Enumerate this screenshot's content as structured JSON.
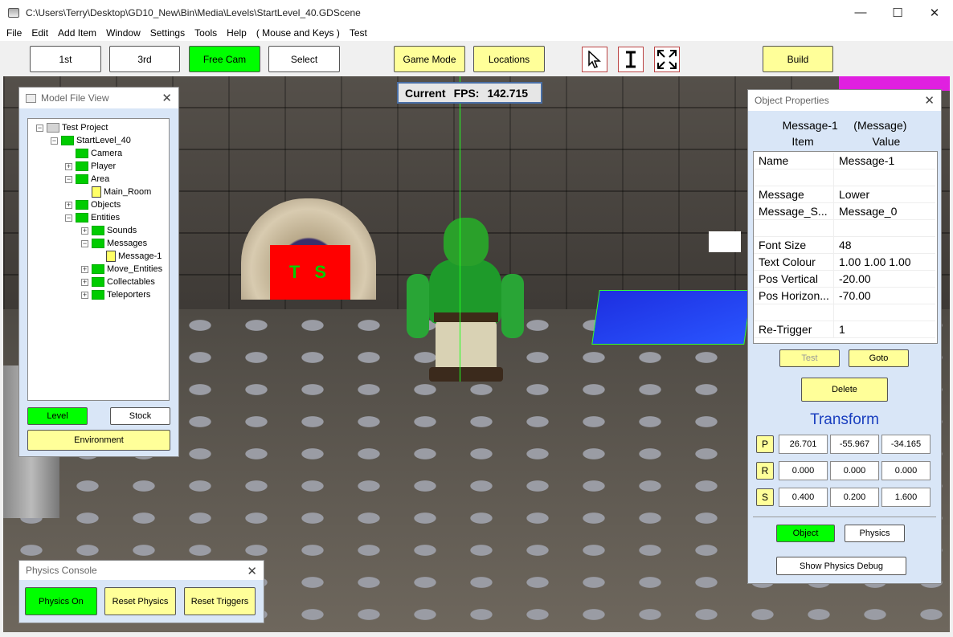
{
  "window": {
    "title": "C:\\Users\\Terry\\Desktop\\GD10_New\\Bin\\Media\\Levels\\StartLevel_40.GDScene",
    "minimize_glyph": "—",
    "maximize_glyph": "☐",
    "close_glyph": "✕"
  },
  "menu": [
    "File",
    "Edit",
    "Add Item",
    "Window",
    "Settings",
    "Tools",
    "Help",
    "( Mouse and Keys )",
    "Test"
  ],
  "toolbar": {
    "first": "1st",
    "third": "3rd",
    "free_cam": "Free Cam",
    "select": "Select",
    "game_mode": "Game Mode",
    "locations": "Locations",
    "build": "Build"
  },
  "viewport": {
    "fps_label": "Current",
    "fps_name": "FPS:",
    "fps_value": "142.715",
    "ts_text": "T S"
  },
  "model_file_view": {
    "title": "Model File View",
    "close": "✕",
    "tree": [
      {
        "label": "Test Project",
        "depth": 0,
        "icon": "folder-grey",
        "expander": "−"
      },
      {
        "label": "StartLevel_40",
        "depth": 1,
        "icon": "folder",
        "expander": "−"
      },
      {
        "label": "Camera",
        "depth": 2,
        "icon": "folder",
        "expander": ""
      },
      {
        "label": "Player",
        "depth": 2,
        "icon": "folder",
        "expander": "+"
      },
      {
        "label": "Area",
        "depth": 2,
        "icon": "folder",
        "expander": "−"
      },
      {
        "label": "Main_Room",
        "depth": 3,
        "icon": "file",
        "expander": ""
      },
      {
        "label": "Objects",
        "depth": 2,
        "icon": "folder",
        "expander": "+"
      },
      {
        "label": "Entities",
        "depth": 2,
        "icon": "folder",
        "expander": "−"
      },
      {
        "label": "Sounds",
        "depth": 3,
        "icon": "folder",
        "expander": "+"
      },
      {
        "label": "Messages",
        "depth": 3,
        "icon": "folder",
        "expander": "−"
      },
      {
        "label": "Message-1",
        "depth": 4,
        "icon": "file",
        "expander": ""
      },
      {
        "label": "Move_Entities",
        "depth": 3,
        "icon": "folder",
        "expander": "+"
      },
      {
        "label": "Collectables",
        "depth": 3,
        "icon": "folder",
        "expander": "+"
      },
      {
        "label": "Teleporters",
        "depth": 3,
        "icon": "folder",
        "expander": "+"
      }
    ],
    "level_button": "Level",
    "stock_button": "Stock",
    "environment_button": "Environment"
  },
  "physics_console": {
    "title": "Physics Console",
    "close": "✕",
    "physics_on": "Physics On",
    "reset_physics": "Reset Physics",
    "reset_triggers": "Reset Triggers"
  },
  "object_properties": {
    "title": "Object Properties",
    "close": "✕",
    "object_name": "Message-1",
    "object_type": "(Message)",
    "col_item": "Item",
    "col_value": "Value",
    "rows": [
      {
        "k": "Name",
        "v": "Message-1"
      },
      {
        "k": "",
        "v": ""
      },
      {
        "k": "Message",
        "v": "Lower"
      },
      {
        "k": "Message_S...",
        "v": "Message_0"
      },
      {
        "k": "",
        "v": ""
      },
      {
        "k": "Font Size",
        "v": "48"
      },
      {
        "k": "Text Colour",
        "v": "1.00 1.00 1.00"
      },
      {
        "k": "Pos Vertical",
        "v": "-20.00"
      },
      {
        "k": "Pos Horizon...",
        "v": "-70.00"
      },
      {
        "k": "",
        "v": ""
      },
      {
        "k": "Re-Trigger",
        "v": "1"
      }
    ],
    "test_button": "Test",
    "goto_button": "Goto",
    "delete_button": "Delete",
    "transform_title": "Transform",
    "position_label": "P",
    "rotation_label": "R",
    "scale_label": "S",
    "position": [
      "26.701",
      "-55.967",
      "-34.165"
    ],
    "rotation": [
      "0.000",
      "0.000",
      "0.000"
    ],
    "scale": [
      "0.400",
      "0.200",
      "1.600"
    ],
    "object_button": "Object",
    "physics_button": "Physics",
    "show_physics_debug_button": "Show Physics Debug"
  }
}
